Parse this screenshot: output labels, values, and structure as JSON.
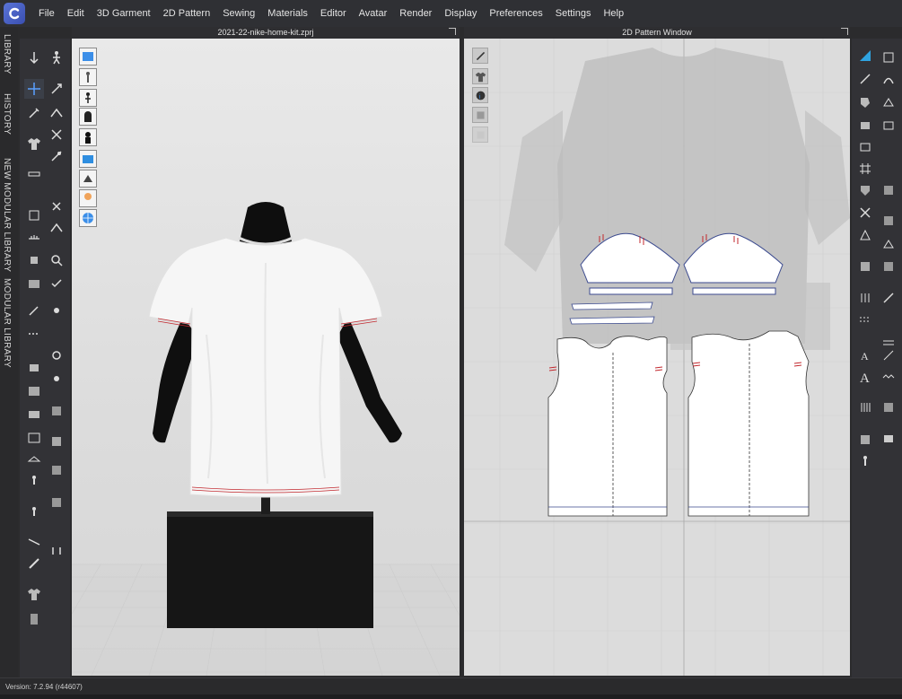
{
  "menubar": {
    "items": [
      "File",
      "Edit",
      "3D Garment",
      "2D Pattern",
      "Sewing",
      "Materials",
      "Editor",
      "Avatar",
      "Render",
      "Display",
      "Preferences",
      "Settings",
      "Help"
    ]
  },
  "side_tabs": [
    "LIBRARY",
    "HISTORY",
    "NEW MODULAR LIBRARY",
    "MODULAR LIBRARY"
  ],
  "view3d": {
    "title": "2021-22-nike-home-kit.zprj"
  },
  "view2d": {
    "title": "2D Pattern Window"
  },
  "statusbar": {
    "version": "Version: 7.2.94 (r44607)"
  },
  "colors": {
    "accent": "#4a6fd6",
    "stitch": "#c2272d",
    "pattern_outline": "#3b4a8f",
    "garment": "#f5f5f5",
    "mannequin": "#111111"
  }
}
